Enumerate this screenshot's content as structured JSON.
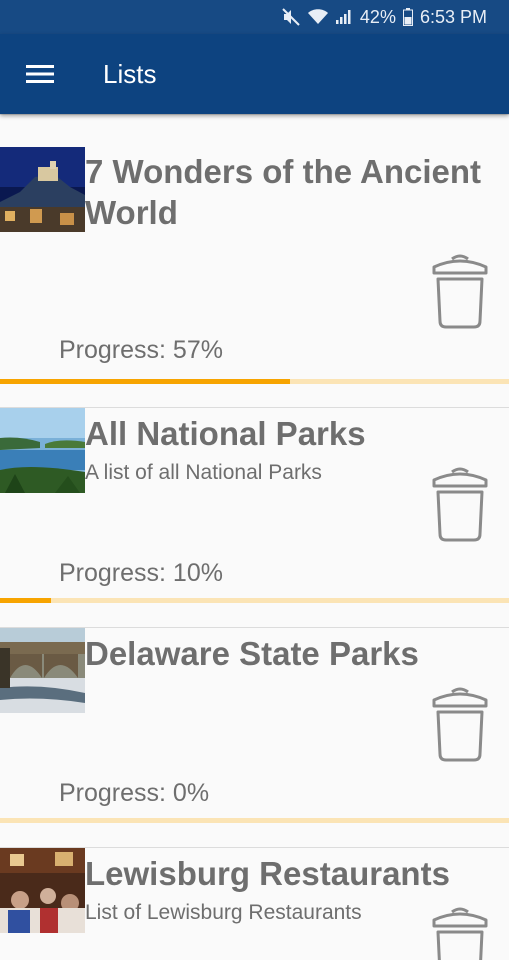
{
  "status_bar": {
    "battery": "42%",
    "time": "6:53 PM",
    "icons": [
      "mute-icon",
      "wifi-icon",
      "signal-icon",
      "battery-icon"
    ]
  },
  "app_bar": {
    "title": "Lists",
    "menu_icon": "hamburger-menu-icon"
  },
  "colors": {
    "app_bar": "#0d4380",
    "status_bar": "#174a84",
    "progress_fill": "#f7a400",
    "progress_track": "#fbe4b5",
    "text": "#6e6e6e"
  },
  "lists": [
    {
      "title": "7 Wonders of the Ancient World",
      "subtitle": "",
      "progress_label": "Progress: 57%",
      "progress": 0.57,
      "thumbnail": "castle-at-night-photo",
      "delete_icon": "trash-icon"
    },
    {
      "title": "All National Parks",
      "subtitle": "A list of all National Parks",
      "progress_label": "Progress: 10%",
      "progress": 0.1,
      "thumbnail": "lake-islands-photo",
      "delete_icon": "trash-icon"
    },
    {
      "title": "Delaware State Parks",
      "subtitle": "",
      "progress_label": "Progress: 0%",
      "progress": 0.0,
      "thumbnail": "stone-bridge-river-photo",
      "delete_icon": "trash-icon"
    },
    {
      "title": "Lewisburg Restaurants",
      "subtitle": "List of Lewisburg Restaurants",
      "progress_label": "",
      "progress": null,
      "thumbnail": "restaurant-interior-photo",
      "delete_icon": "trash-icon"
    }
  ]
}
